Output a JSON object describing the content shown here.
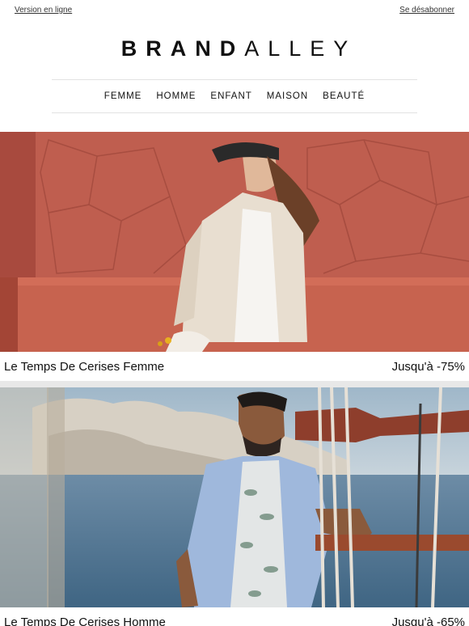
{
  "header": {
    "online_version": "Version en ligne",
    "unsubscribe": "Se désabonner"
  },
  "logo": {
    "part_bold": "BRAND",
    "part_light": "ALLEY"
  },
  "nav": [
    "FEMME",
    "HOMME",
    "ENFANT",
    "MAISON",
    "BEAUTÉ"
  ],
  "banners": [
    {
      "title": "Le Temps De Cerises Femme",
      "discount": "Jusqu'à -75%"
    },
    {
      "title": "Le Temps De Cerises Homme",
      "discount": "Jusqu'à -65%"
    }
  ]
}
